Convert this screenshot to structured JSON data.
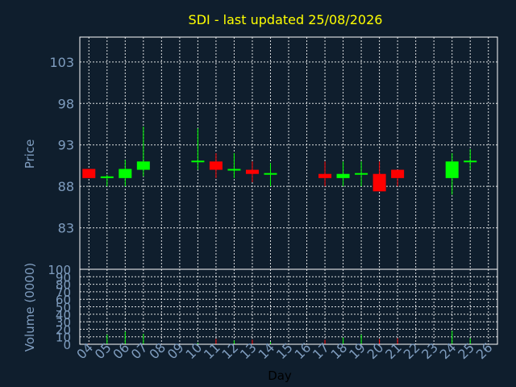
{
  "chart_data": [
    {
      "type": "candlestick",
      "title": "SDI - last updated 25/08/2026",
      "ylabel": "Price",
      "ylim": [
        78,
        106
      ],
      "yticks": [
        "83",
        "88",
        "93",
        "98",
        "103"
      ],
      "grid": true,
      "up_color": "#00ff00",
      "down_color": "#ff0000",
      "candles": [
        {
          "day": "04",
          "open": 90.1,
          "close": 89.0,
          "high": 90.1,
          "low": 89.0
        },
        {
          "day": "05",
          "open": 89.0,
          "close": 89.2,
          "high": 89.4,
          "low": 88.0
        },
        {
          "day": "06",
          "open": 89.0,
          "close": 90.1,
          "high": 91.2,
          "low": 88.0
        },
        {
          "day": "07",
          "open": 90.0,
          "close": 91.0,
          "high": 95.2,
          "low": 89.2
        },
        {
          "day": "10",
          "open": 91.0,
          "close": 91.1,
          "high": 95.0,
          "low": 90.0
        },
        {
          "day": "11",
          "open": 91.0,
          "close": 90.0,
          "high": 92.0,
          "low": 89.0
        },
        {
          "day": "12",
          "open": 90.0,
          "close": 90.1,
          "high": 92.0,
          "low": 89.0
        },
        {
          "day": "13",
          "open": 90.0,
          "close": 89.5,
          "high": 91.0,
          "low": 88.5
        },
        {
          "day": "14",
          "open": 89.5,
          "close": 89.6,
          "high": 90.8,
          "low": 88.0
        },
        {
          "day": "17",
          "open": 89.5,
          "close": 89.0,
          "high": 91.0,
          "low": 88.0
        },
        {
          "day": "18",
          "open": 89.0,
          "close": 89.5,
          "high": 91.0,
          "low": 88.0
        },
        {
          "day": "19",
          "open": 89.5,
          "close": 89.6,
          "high": 91.0,
          "low": 88.0
        },
        {
          "day": "20",
          "open": 89.5,
          "close": 87.4,
          "high": 91.0,
          "low": 87.4
        },
        {
          "day": "21",
          "open": 90.0,
          "close": 89.0,
          "high": 90.0,
          "low": 88.0
        },
        {
          "day": "24",
          "open": 89.0,
          "close": 91.0,
          "high": 92.0,
          "low": 87.0
        },
        {
          "day": "25",
          "open": 91.0,
          "close": 91.1,
          "high": 92.5,
          "low": 90.0
        }
      ]
    },
    {
      "type": "bar",
      "ylabel": "Volume (0000)",
      "ylim": [
        0,
        100
      ],
      "yticks": [
        "0",
        "10",
        "20",
        "30",
        "40",
        "50",
        "60",
        "70",
        "80",
        "90",
        "100"
      ],
      "xlabel": "Day",
      "categories": [
        "04",
        "05",
        "06",
        "07",
        "08",
        "09",
        "10",
        "11",
        "12",
        "13",
        "14",
        "15",
        "16",
        "17",
        "18",
        "19",
        "20",
        "21",
        "22",
        "23",
        "24",
        "25",
        "26"
      ],
      "values": [
        {
          "day": "04",
          "value": 1,
          "direction": "down"
        },
        {
          "day": "05",
          "value": 13,
          "direction": "up"
        },
        {
          "day": "06",
          "value": 17,
          "direction": "up"
        },
        {
          "day": "07",
          "value": 14,
          "direction": "up"
        },
        {
          "day": "10",
          "value": 2,
          "direction": "up"
        },
        {
          "day": "11",
          "value": 7,
          "direction": "down"
        },
        {
          "day": "12",
          "value": 5,
          "direction": "up"
        },
        {
          "day": "13",
          "value": 6,
          "direction": "down"
        },
        {
          "day": "14",
          "value": 3,
          "direction": "up"
        },
        {
          "day": "17",
          "value": 6,
          "direction": "down"
        },
        {
          "day": "18",
          "value": 9,
          "direction": "up"
        },
        {
          "day": "19",
          "value": 13,
          "direction": "up"
        },
        {
          "day": "20",
          "value": 7,
          "direction": "down"
        },
        {
          "day": "21",
          "value": 8,
          "direction": "down"
        },
        {
          "day": "24",
          "value": 18,
          "direction": "up"
        },
        {
          "day": "25",
          "value": 8,
          "direction": "up"
        }
      ]
    }
  ]
}
